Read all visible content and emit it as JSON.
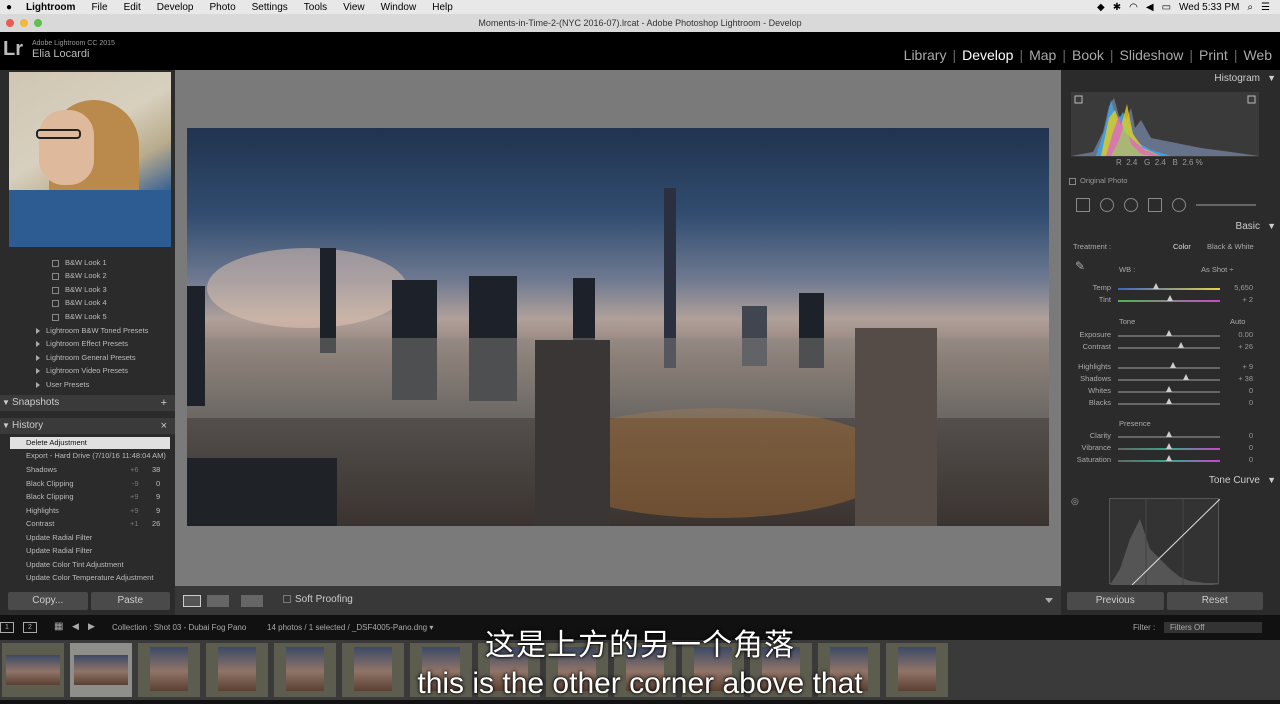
{
  "menubar": {
    "app": "Lightroom",
    "items": [
      "File",
      "Edit",
      "Develop",
      "Photo",
      "Settings",
      "Tools",
      "View",
      "Window",
      "Help"
    ],
    "clock": "Wed 5:33 PM"
  },
  "window": {
    "title": "Moments-in-Time-2-(NYC 2016-07).lrcat - Adobe Photoshop Lightroom - Develop"
  },
  "identity": {
    "product": "Adobe Lightroom CC 2015",
    "user": "Elia Locardi"
  },
  "modules": [
    "Library",
    "Develop",
    "Map",
    "Book",
    "Slideshow",
    "Print",
    "Web"
  ],
  "left": {
    "presets": [
      "B&W Look 1",
      "B&W Look 2",
      "B&W Look 3",
      "B&W Look 4",
      "B&W Look 5"
    ],
    "folders": [
      "Lightroom B&W Toned Presets",
      "Lightroom Effect Presets",
      "Lightroom General Presets",
      "Lightroom Video Presets",
      "User Presets"
    ],
    "snapshots": "Snapshots",
    "snapshots_add": "+",
    "history": "History",
    "history_close": "×",
    "history_items": [
      {
        "name": "Delete Adjustment",
        "a": "",
        "b": ""
      },
      {
        "name": "Export - Hard Drive (7/10/16 11:48:04 AM)",
        "a": "",
        "b": ""
      },
      {
        "name": "Shadows",
        "a": "+6",
        "b": "38"
      },
      {
        "name": "Black Clipping",
        "a": "-9",
        "b": "0"
      },
      {
        "name": "Black Clipping",
        "a": "+9",
        "b": "9"
      },
      {
        "name": "Highlights",
        "a": "+9",
        "b": "9"
      },
      {
        "name": "Contrast",
        "a": "+1",
        "b": "26"
      },
      {
        "name": "Update Radial Filter",
        "a": "",
        "b": ""
      },
      {
        "name": "Update Radial Filter",
        "a": "",
        "b": ""
      },
      {
        "name": "Update Color Tint Adjustment",
        "a": "",
        "b": ""
      },
      {
        "name": "Update Color Temperature Adjustment",
        "a": "",
        "b": ""
      }
    ],
    "copy": "Copy...",
    "paste": "Paste"
  },
  "toolbar": {
    "soft_proofing": "Soft Proofing"
  },
  "right": {
    "histogram": "Histogram",
    "rgb": {
      "r_label": "R",
      "r": "2.4",
      "g_label": "G",
      "g": "2.4",
      "b_label": "B",
      "b": "2.6",
      "unit": "%"
    },
    "original_photo": "Original Photo",
    "basic": "Basic",
    "treatment_label": "Treatment :",
    "treatment_color": "Color",
    "treatment_bw": "Black & White",
    "wb_label": "WB :",
    "wb_value": "As Shot ÷",
    "temp": {
      "label": "Temp",
      "value": "5,650"
    },
    "tint": {
      "label": "Tint",
      "value": "+ 2"
    },
    "tone": "Tone",
    "auto": "Auto",
    "exposure": {
      "label": "Exposure",
      "value": "0.00"
    },
    "contrast": {
      "label": "Contrast",
      "value": "+ 26"
    },
    "highlights": {
      "label": "Highlights",
      "value": "+ 9"
    },
    "shadows": {
      "label": "Shadows",
      "value": "+ 38"
    },
    "whites": {
      "label": "Whites",
      "value": "0"
    },
    "blacks": {
      "label": "Blacks",
      "value": "0"
    },
    "presence": "Presence",
    "clarity": {
      "label": "Clarity",
      "value": "0"
    },
    "vibrance": {
      "label": "Vibrance",
      "value": "0"
    },
    "saturation": {
      "label": "Saturation",
      "value": "0"
    },
    "tone_curve": "Tone Curve",
    "previous": "Previous",
    "reset": "Reset"
  },
  "filmstrip": {
    "page1": "1",
    "page2": "2",
    "collection": "Collection : Shot 03 - Dubai Fog Pano",
    "count": "14 photos / 1 selected / _DSF4005-Pano.dng ▾",
    "filter_label": "Filter :",
    "filter_value": "Filters Off"
  },
  "subtitles": {
    "zh": "这是上方的另一个角落",
    "en": "this is the other corner above that"
  }
}
